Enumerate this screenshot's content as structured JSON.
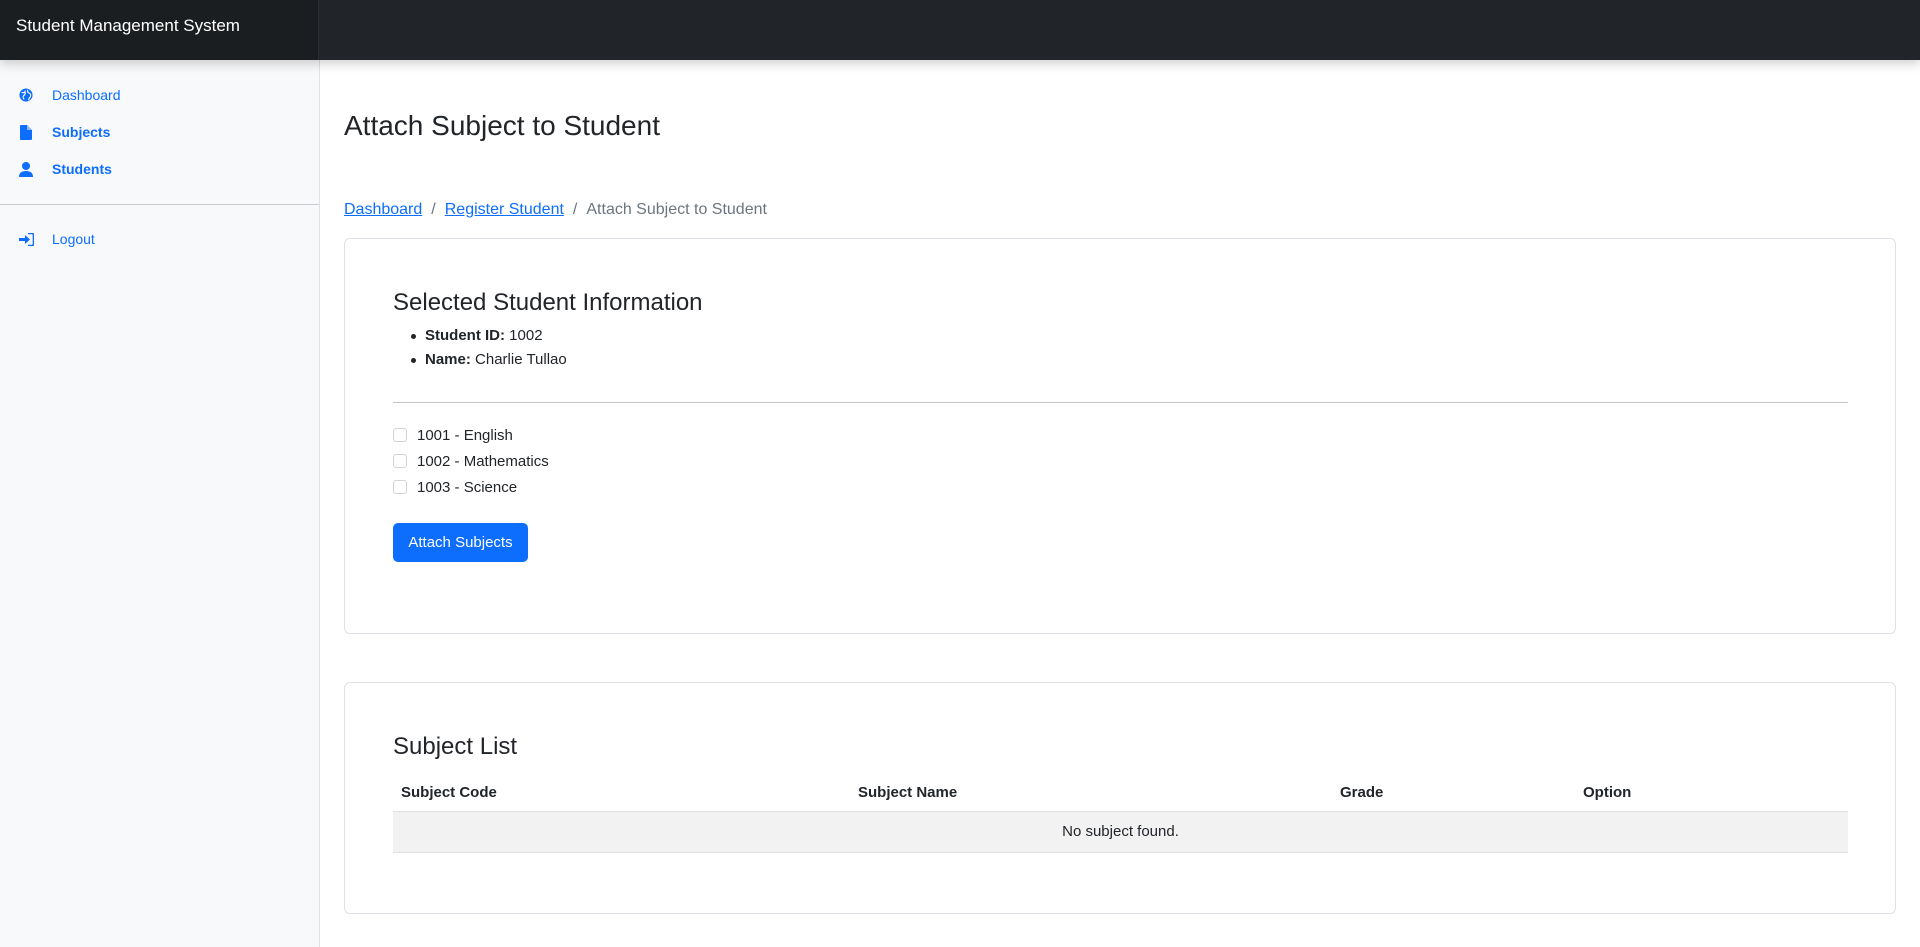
{
  "app": {
    "brand": "Student Management System"
  },
  "sidebar": {
    "items": [
      {
        "label": "Dashboard",
        "icon": "globe-icon"
      },
      {
        "label": "Subjects",
        "icon": "file-icon"
      },
      {
        "label": "Students",
        "icon": "user-icon"
      }
    ],
    "logout": {
      "label": "Logout",
      "icon": "sign-in-icon"
    }
  },
  "page": {
    "title": "Attach Subject to Student"
  },
  "breadcrumb": {
    "items": [
      "Dashboard",
      "Register Student"
    ],
    "current": "Attach Subject to Student"
  },
  "student_card": {
    "title": "Selected Student Information",
    "id_label": "Student ID:",
    "id_value": "1002",
    "name_label": "Name:",
    "name_value": "Charlie Tullao"
  },
  "subjects": [
    {
      "label": "1001 - English",
      "checked": false
    },
    {
      "label": "1002 - Mathematics",
      "checked": false
    },
    {
      "label": "1003 - Science",
      "checked": false
    }
  ],
  "attach_button": "Attach Subjects",
  "subject_list": {
    "title": "Subject List",
    "columns": [
      "Subject Code",
      "Subject Name",
      "Grade",
      "Option"
    ],
    "empty_message": "No subject found."
  },
  "colors": {
    "accent": "#0d6efd",
    "topbar": "#212529",
    "sidebar_bg": "#f8f9fa"
  }
}
